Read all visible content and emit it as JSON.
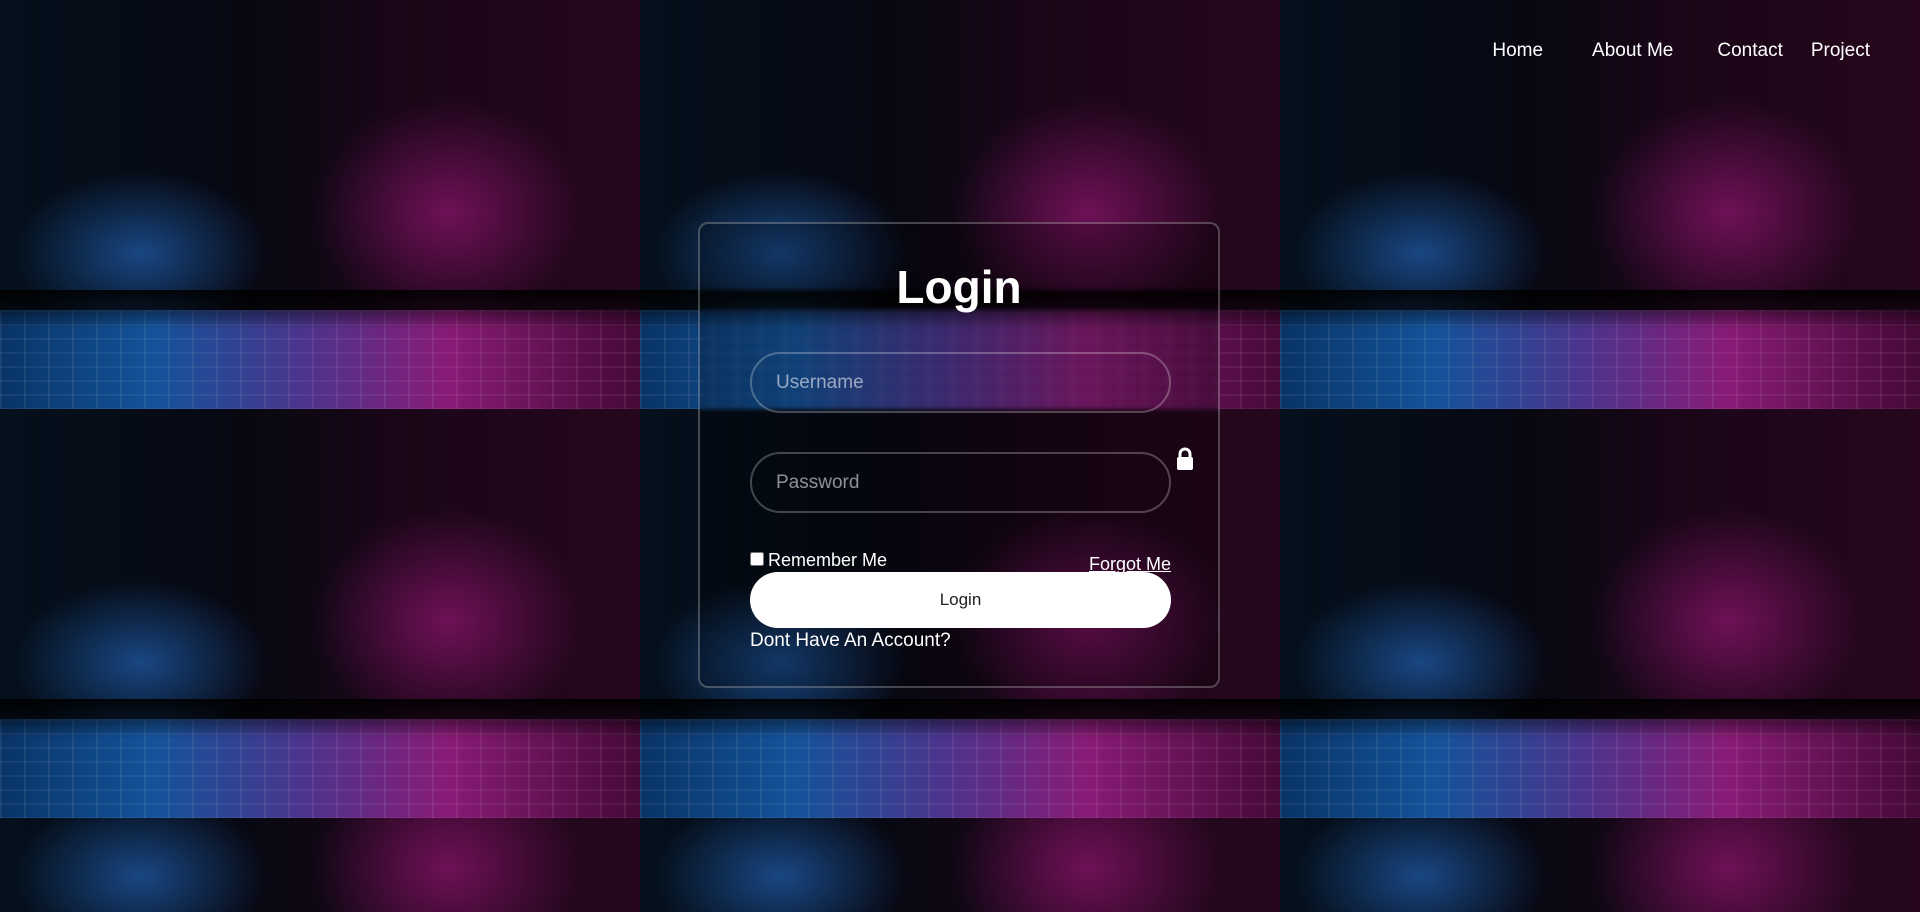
{
  "nav": {
    "items": [
      {
        "label": "Home"
      },
      {
        "label": "About Me"
      },
      {
        "label": "Contact"
      },
      {
        "label": "Project"
      }
    ]
  },
  "login": {
    "title": "Login",
    "username_placeholder": "Username",
    "password_placeholder": "Password",
    "remember_label": "Remember Me",
    "remember_checked": false,
    "forgot_label": "Forgot Me",
    "button_label": "Login",
    "signup_label": "Dont Have An Account?"
  },
  "icons": {
    "lock": "lock-icon"
  },
  "colors": {
    "accent_blue": "#1763b7",
    "accent_magenta": "#a0208a",
    "text": "#ffffff",
    "button_bg": "#ffffff"
  }
}
